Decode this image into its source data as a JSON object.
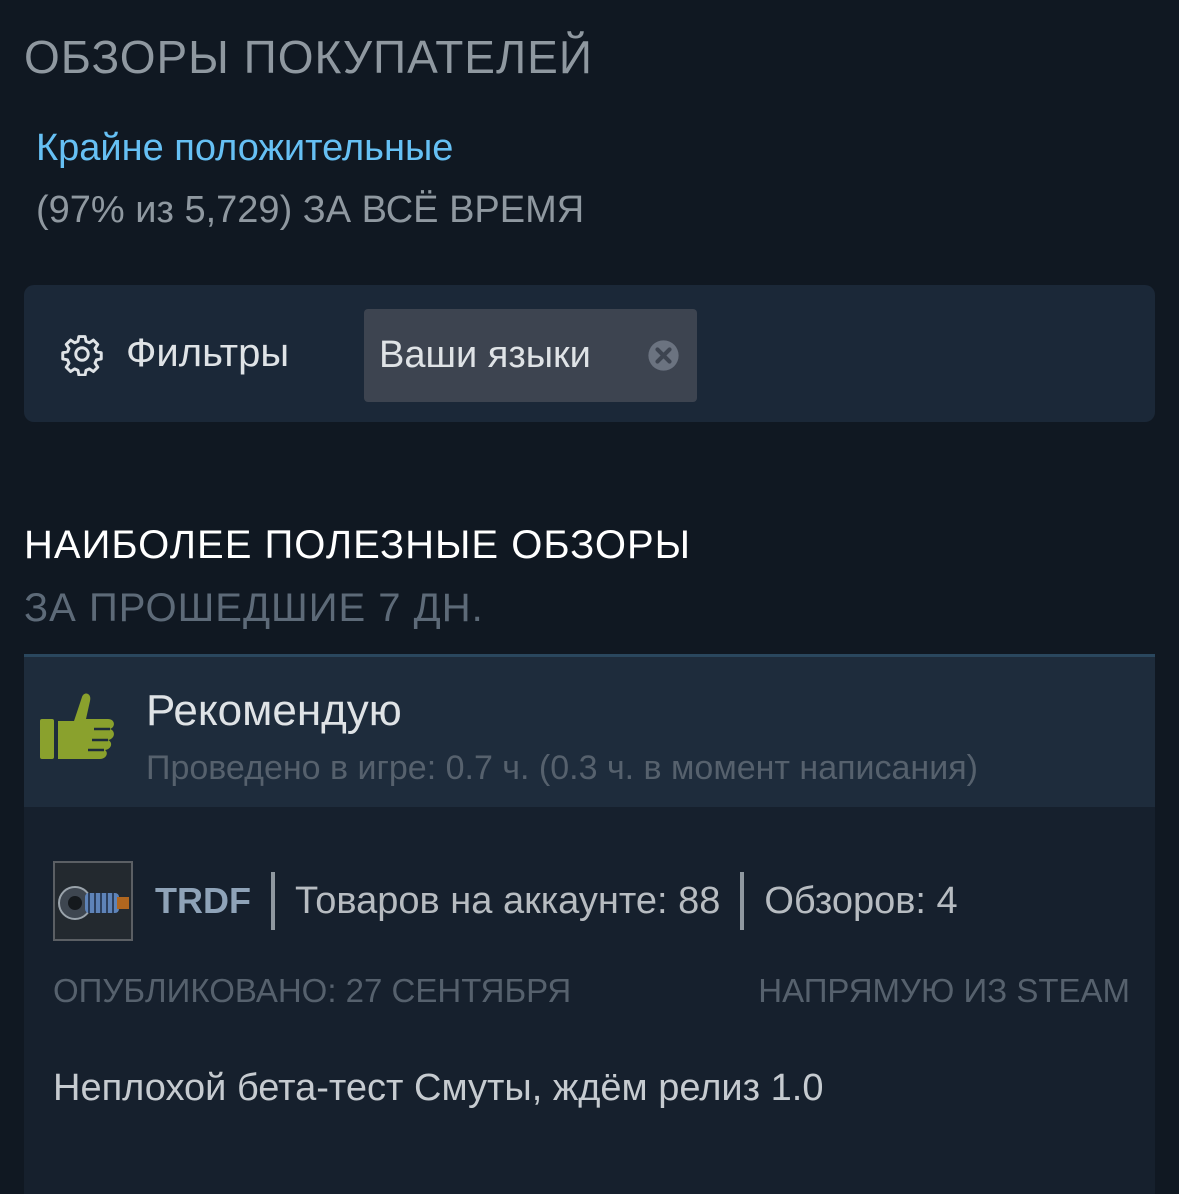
{
  "header": {
    "title": "ОБЗОРЫ ПОКУПАТЕЛЕЙ"
  },
  "rating": {
    "label": "Крайне положительные",
    "summary": "(97% из 5,729) ЗА ВСЁ ВРЕМЯ"
  },
  "filters": {
    "button_label": "Фильтры",
    "button_icon": "gear-icon",
    "active_chip": "Ваши языки",
    "chip_remove_icon": "close-circle-icon"
  },
  "helpful": {
    "title": "НАИБОЛЕЕ ПОЛЕЗНЫЕ ОБЗОРЫ",
    "period": "ЗА ПРОШЕДШИЕ 7 ДН."
  },
  "review": {
    "recommendation": "Рекомендую",
    "recommendation_icon": "thumbs-up-icon",
    "playtime": "Проведено в игре: 0.7 ч. (0.3 ч. в момент написания)",
    "author": "TRDF",
    "products": "Товаров на аккаунте: 88",
    "reviews": "Обзоров: 4",
    "posted": "ОПУБЛИКОВАНО: 27 СЕНТЯБРЯ",
    "source": "НАПРЯМУЮ ИЗ STEAM",
    "text": "Неплохой бета-тест Смуты, ждём релиз 1.0"
  },
  "colors": {
    "background": "#101822",
    "panel": "#1b2838",
    "link_blue": "#66c0f4",
    "thumb_green": "#8aa12d",
    "muted": "#8f98a0"
  }
}
